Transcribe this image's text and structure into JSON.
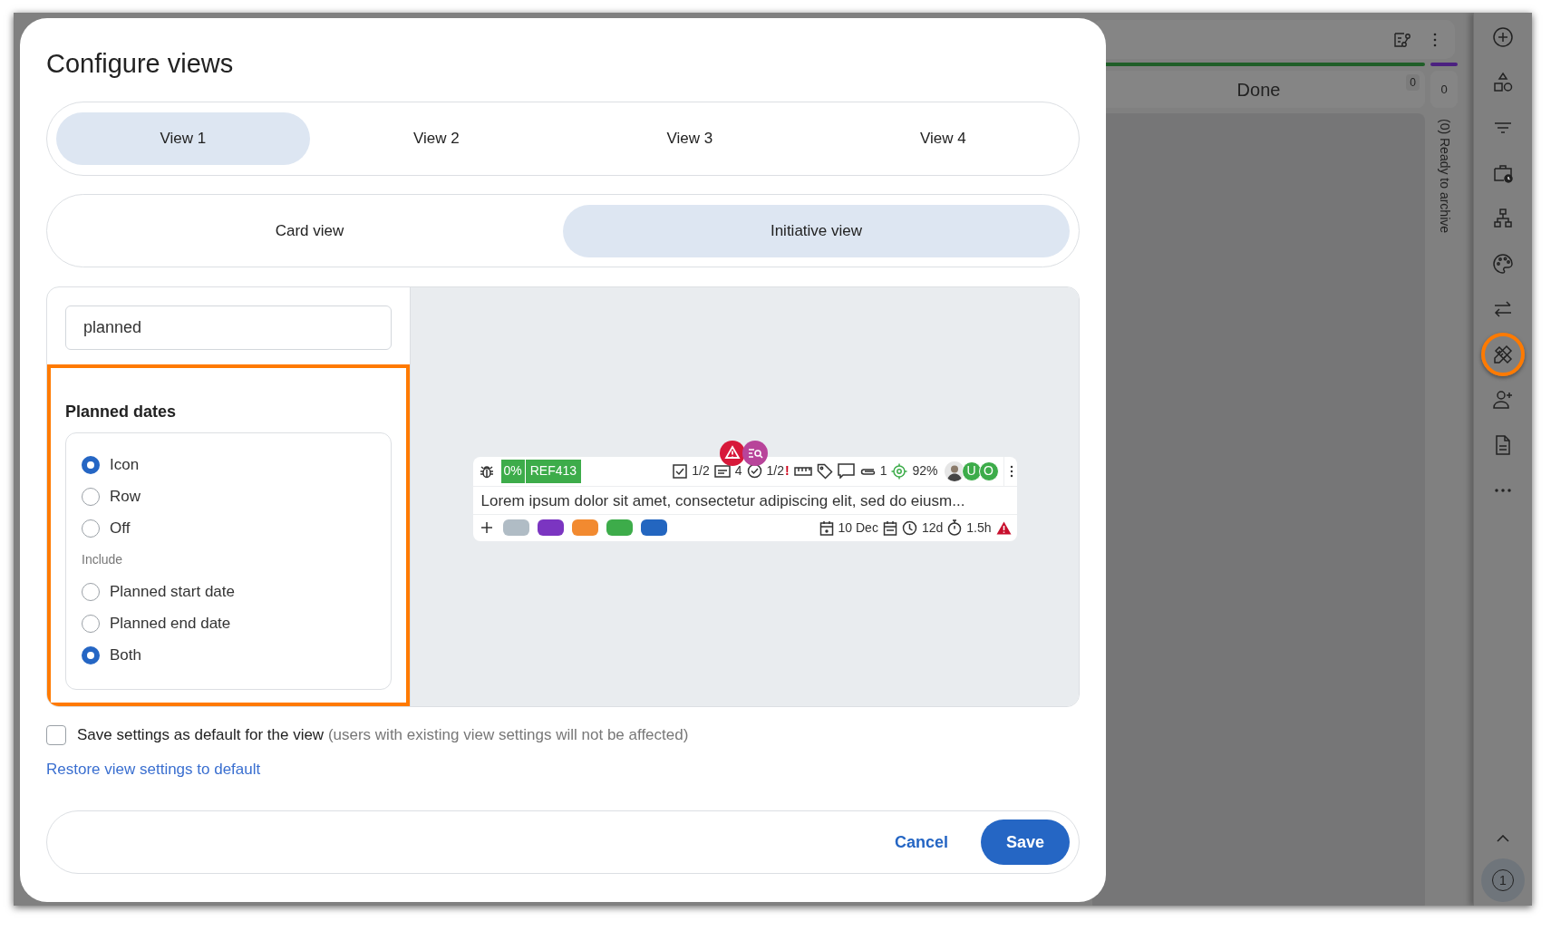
{
  "dialog": {
    "title": "Configure views"
  },
  "view_tabs": [
    {
      "label": "View 1",
      "selected": true
    },
    {
      "label": "View 2",
      "selected": false
    },
    {
      "label": "View 3",
      "selected": false
    },
    {
      "label": "View 4",
      "selected": false
    }
  ],
  "mode_tabs": [
    {
      "label": "Card view",
      "selected": false
    },
    {
      "label": "Initiative view",
      "selected": true
    }
  ],
  "search": {
    "value": "planned"
  },
  "planned_dates": {
    "title": "Planned dates",
    "display_options": [
      {
        "label": "Icon",
        "selected": true
      },
      {
        "label": "Row",
        "selected": false
      },
      {
        "label": "Off",
        "selected": false
      }
    ],
    "include_label": "Include",
    "include_options": [
      {
        "label": "Planned start date",
        "selected": false
      },
      {
        "label": "Planned end date",
        "selected": false
      },
      {
        "label": "Both",
        "selected": true
      }
    ]
  },
  "preview_card": {
    "progress": "0%",
    "reference": "REF413",
    "checklist": "1/2",
    "cards": "4",
    "approvals": "1/2",
    "alert_mark": "!",
    "attachments": "1",
    "score": "92%",
    "members": [
      "U",
      "O"
    ],
    "description": "Lorem ipsum dolor sit amet, consectetur adipiscing elit, sed do eiusm...",
    "tags": [
      {
        "color": "#b0bcc5"
      },
      {
        "color": "#7b35c1"
      },
      {
        "color": "#f28a30"
      },
      {
        "color": "#3dac4a"
      },
      {
        "color": "#2366c0"
      }
    ],
    "due_date": "10 Dec",
    "duration": "12d",
    "time_logged": "1.5h"
  },
  "default_setting": {
    "label": "Save settings as default for the view",
    "note": "(users with existing view settings will not be affected)",
    "checked": false
  },
  "restore_link": "Restore view settings to default",
  "buttons": {
    "cancel": "Cancel",
    "save": "Save"
  },
  "background": {
    "column_title": "Done",
    "column_count": "0",
    "collapsed_count": "0",
    "collapsed_title": "(0) Ready to archive"
  },
  "sidebar": {
    "items": [
      {
        "kind": "add",
        "highlighted": false
      },
      {
        "kind": "shapes",
        "highlighted": false
      },
      {
        "kind": "filter",
        "highlighted": false
      },
      {
        "kind": "schedule",
        "highlighted": false
      },
      {
        "kind": "hierarchy",
        "highlighted": false
      },
      {
        "kind": "palette",
        "highlighted": false
      },
      {
        "kind": "swap",
        "highlighted": false
      },
      {
        "kind": "tools",
        "highlighted": true
      },
      {
        "kind": "add-user",
        "highlighted": false
      },
      {
        "kind": "document",
        "highlighted": false
      },
      {
        "kind": "more",
        "highlighted": false
      }
    ],
    "help_badge": "1"
  }
}
